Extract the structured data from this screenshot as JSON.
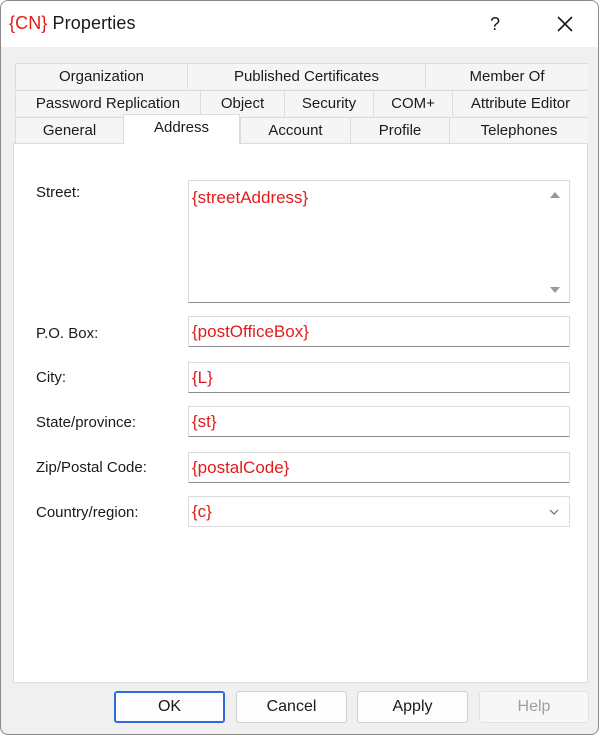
{
  "window": {
    "title_cn": "{CN}",
    "title": "Properties",
    "help_label": "?"
  },
  "tabs": {
    "row1": [
      "Organization",
      "Published Certificates",
      "Member Of"
    ],
    "row2": [
      "Password Replication",
      "Object",
      "Security",
      "COM+",
      "Attribute Editor"
    ],
    "row3": [
      "General",
      "Address",
      "Account",
      "Profile",
      "Telephones"
    ],
    "active": "Address"
  },
  "form": {
    "street_label": "Street:",
    "street_value": "{streetAddress}",
    "pobox_label": "P.O. Box:",
    "pobox_value": "{postOfficeBox}",
    "city_label": "City:",
    "city_value": "{L}",
    "state_label": "State/province:",
    "state_value": "{st}",
    "zip_label": "Zip/Postal Code:",
    "zip_value": "{postalCode}",
    "country_label": "Country/region:",
    "country_value": "{c}"
  },
  "buttons": {
    "ok": "OK",
    "cancel": "Cancel",
    "apply": "Apply",
    "help": "Help"
  },
  "icons": {
    "close": "close-icon",
    "dropdown": "chevron-down-icon",
    "scroll_up": "scroll-up-arrow-icon",
    "scroll_down": "scroll-down-arrow-icon"
  },
  "colors": {
    "placeholder_text": "#e11c1c",
    "default_button_border": "#2f6bd6"
  }
}
